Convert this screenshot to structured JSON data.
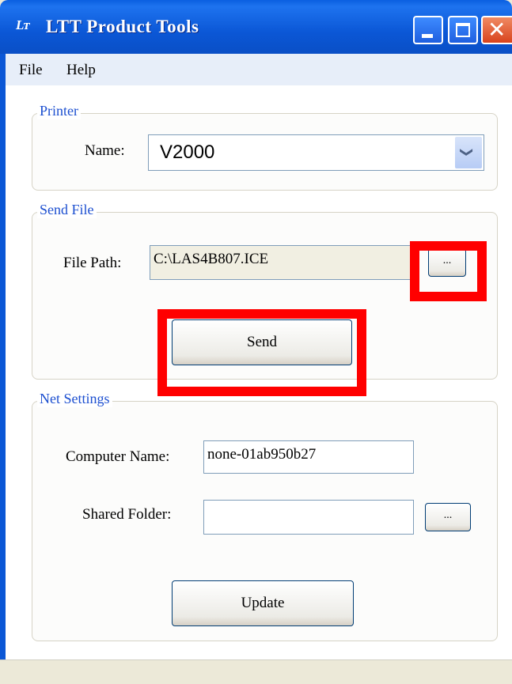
{
  "window": {
    "icon": "lt-logo-icon",
    "icon_text": "Lᴛ",
    "title": "LTT Product Tools",
    "controls": {
      "minimize": "minimize-icon",
      "maximize": "maximize-icon",
      "close": "close-icon",
      "close_glyph": "✕"
    }
  },
  "menu": {
    "items": [
      "File",
      "Help"
    ]
  },
  "printer": {
    "group_title": "Printer",
    "name_label": "Name:",
    "name_value": "V2000",
    "dropdown_icon": "chevron-down-icon",
    "dropdown_glyph": "❯"
  },
  "send_file": {
    "group_title": "Send File",
    "path_label": "File Path:",
    "path_value": "C:\\LAS4B807.ICE",
    "browse_label": "...",
    "send_label": "Send"
  },
  "net_settings": {
    "group_title": "Net Settings",
    "computer_name_label": "Computer Name:",
    "computer_name_value": "none-01ab950b27",
    "shared_folder_label": "Shared Folder:",
    "shared_folder_value": "",
    "browse_label": "...",
    "update_label": "Update"
  },
  "colors": {
    "titlebar": "#0b57d6",
    "group_title": "#1c4fd0",
    "highlight": "#ff0000"
  }
}
